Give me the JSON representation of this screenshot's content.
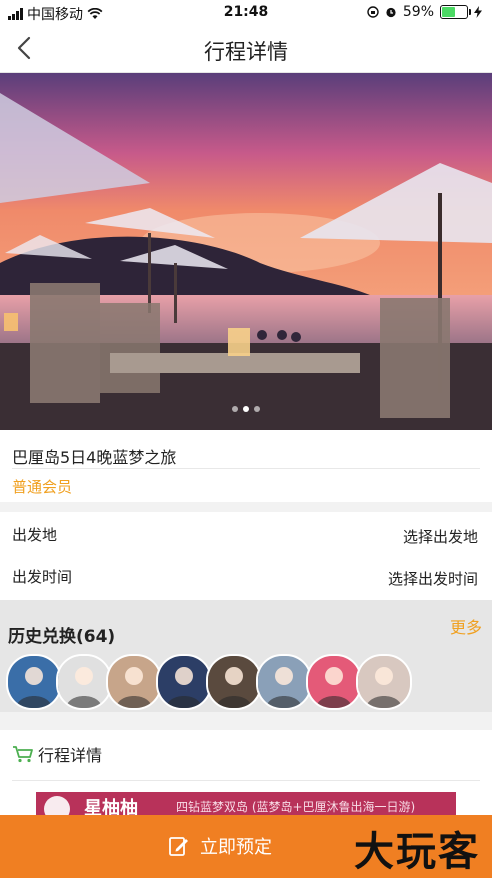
{
  "status": {
    "carrier": "中国移动",
    "time": "21:48",
    "battery_text": "59%",
    "battery_level": 0.59
  },
  "nav": {
    "title": "行程详情"
  },
  "hero": {
    "slides": 3,
    "active_slide": 2
  },
  "trip": {
    "name": "巴厘岛5日4晚蓝梦之旅",
    "tier": "普通会员"
  },
  "departure": {
    "place_label": "出发地",
    "place_value": "选择出发地",
    "time_label": "出发时间",
    "time_value": "选择出发时间"
  },
  "history": {
    "title": "历史兑换(64)",
    "more": "更多",
    "avatar_colors": [
      "#3a6ea8",
      "#e0e0e0",
      "#c7a58a",
      "#2c3e66",
      "#5a4a3e",
      "#8aa0b8",
      "#e45a78",
      "#d8c8c0"
    ]
  },
  "detail": {
    "title": "行程详情",
    "banner_title": "星柚柚",
    "banner_sub": "四钻蓝梦双岛 (蓝梦岛+巴厘沐鲁出海一日游)"
  },
  "bottom": {
    "book_label": "立即预定",
    "watermark": "大玩客"
  },
  "colors": {
    "accent": "#f07f22",
    "tier": "#f0a020"
  }
}
